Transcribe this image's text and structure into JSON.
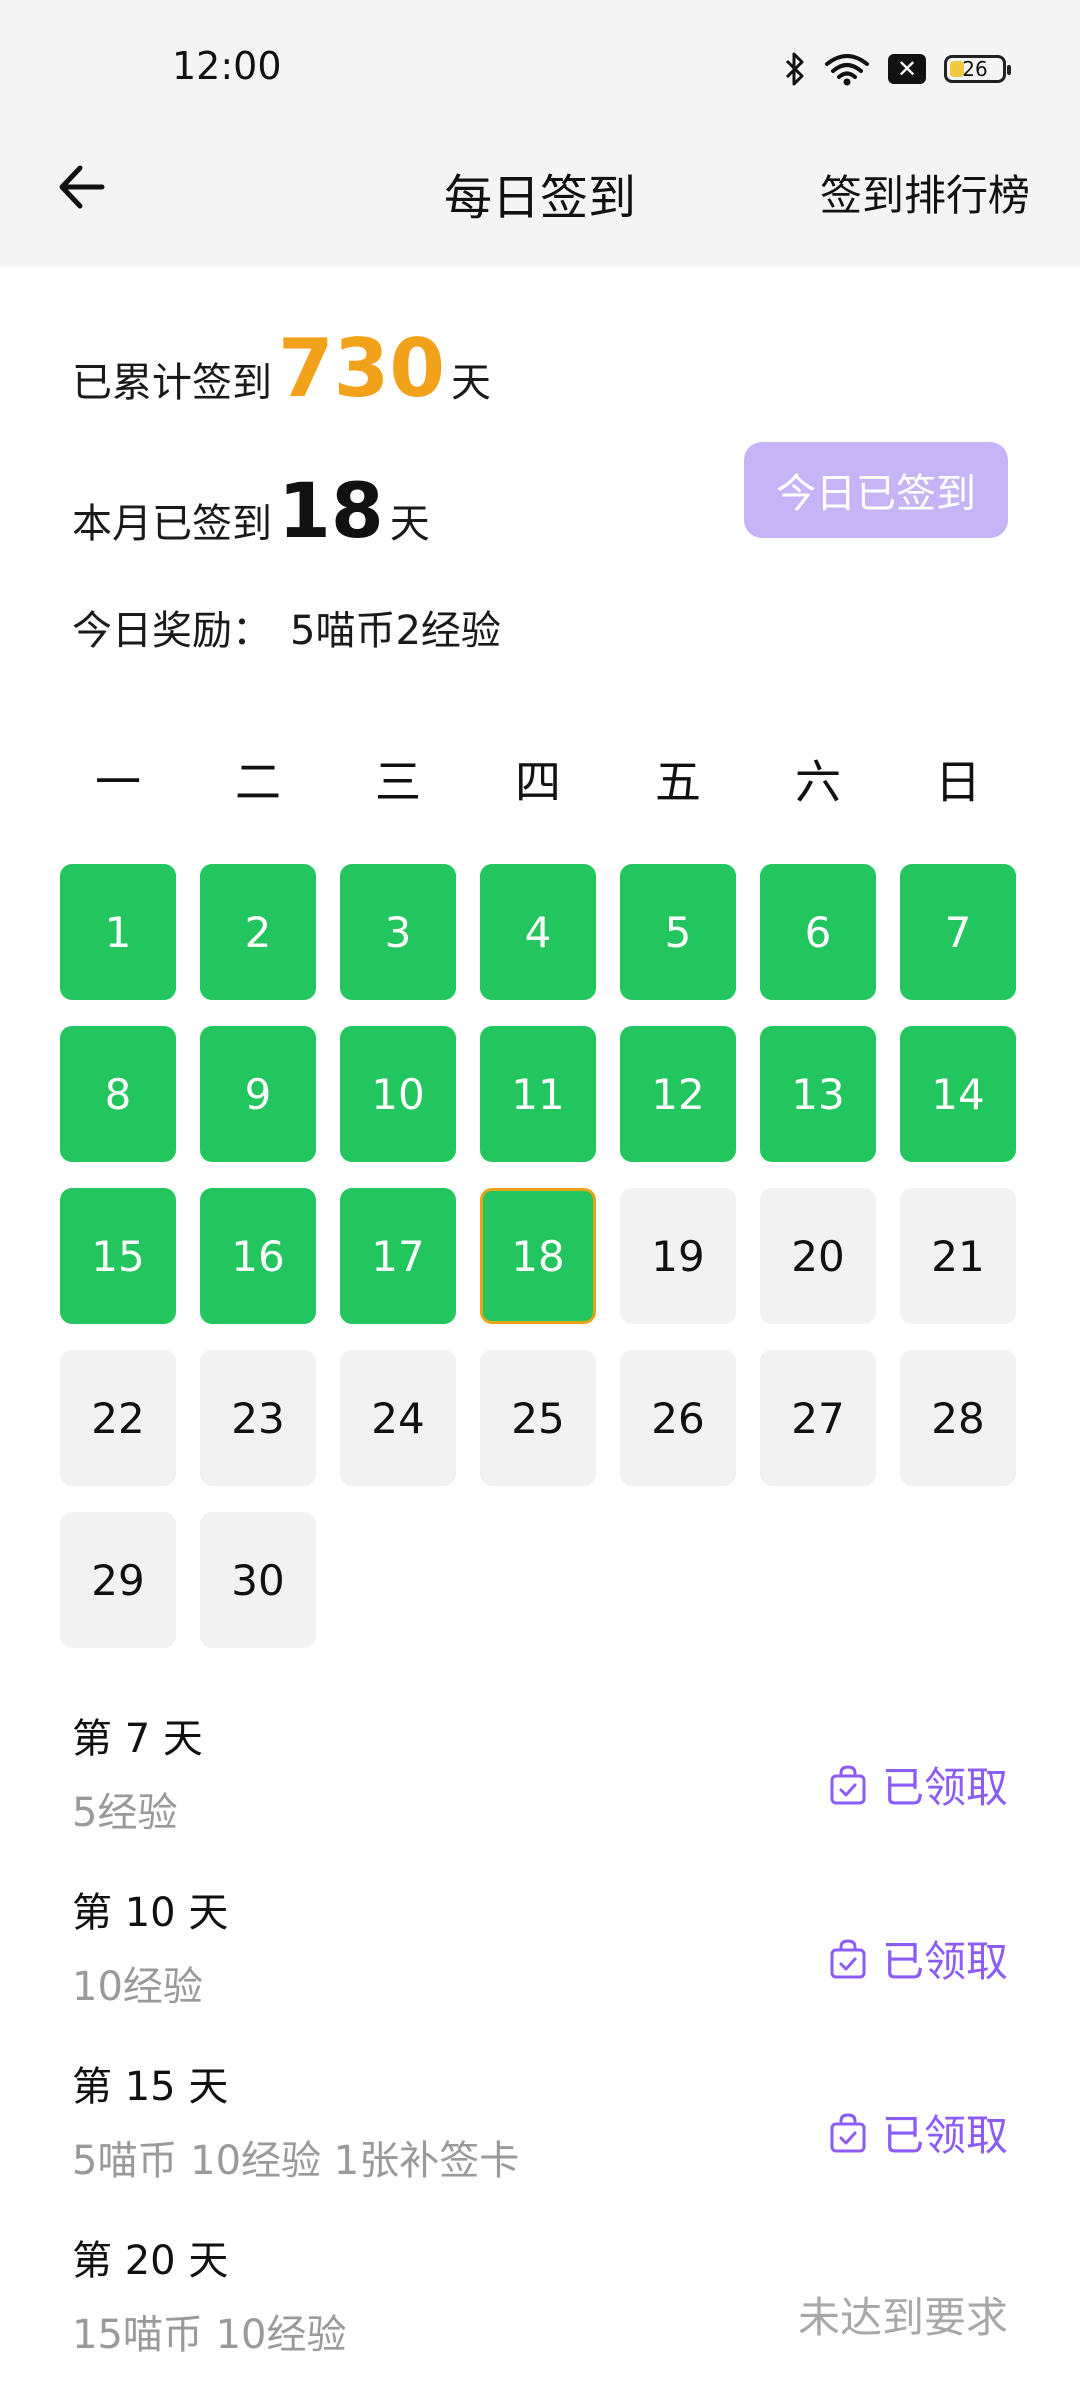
{
  "status_bar": {
    "time": "12:00",
    "battery": "26",
    "icons": [
      "bluetooth-icon",
      "wifi-icon",
      "x-icon",
      "battery-icon"
    ]
  },
  "nav": {
    "back_icon": "arrow-left-icon",
    "title": "每日签到",
    "rank_label": "签到排行榜"
  },
  "summary": {
    "total_prefix": "已累计签到",
    "total_days": "730",
    "total_suffix": "天",
    "month_prefix": "本月已签到",
    "month_days": "18",
    "month_suffix": "天",
    "checked_button": "今日已签到",
    "reward_label": "今日奖励：",
    "reward_value": "5喵币2经验",
    "colors": {
      "total_accent": "#f2a21a",
      "button_bg": "#c6b4f6"
    }
  },
  "calendar": {
    "weekdays": [
      "一",
      "二",
      "三",
      "四",
      "五",
      "六",
      "日"
    ],
    "days": [
      {
        "label": "1",
        "state": "signed"
      },
      {
        "label": "2",
        "state": "signed"
      },
      {
        "label": "3",
        "state": "signed"
      },
      {
        "label": "4",
        "state": "signed"
      },
      {
        "label": "5",
        "state": "signed"
      },
      {
        "label": "6",
        "state": "signed"
      },
      {
        "label": "7",
        "state": "signed"
      },
      {
        "label": "8",
        "state": "signed"
      },
      {
        "label": "9",
        "state": "signed"
      },
      {
        "label": "10",
        "state": "signed"
      },
      {
        "label": "11",
        "state": "signed"
      },
      {
        "label": "12",
        "state": "signed"
      },
      {
        "label": "13",
        "state": "signed"
      },
      {
        "label": "14",
        "state": "signed"
      },
      {
        "label": "15",
        "state": "signed"
      },
      {
        "label": "16",
        "state": "signed"
      },
      {
        "label": "17",
        "state": "signed"
      },
      {
        "label": "18",
        "state": "today"
      },
      {
        "label": "19",
        "state": "unsigned"
      },
      {
        "label": "20",
        "state": "unsigned"
      },
      {
        "label": "21",
        "state": "unsigned"
      },
      {
        "label": "22",
        "state": "unsigned"
      },
      {
        "label": "23",
        "state": "unsigned"
      },
      {
        "label": "24",
        "state": "unsigned"
      },
      {
        "label": "25",
        "state": "unsigned"
      },
      {
        "label": "26",
        "state": "unsigned"
      },
      {
        "label": "27",
        "state": "unsigned"
      },
      {
        "label": "28",
        "state": "unsigned"
      },
      {
        "label": "29",
        "state": "unsigned"
      },
      {
        "label": "30",
        "state": "unsigned"
      }
    ],
    "colors": {
      "signed": "#22c55e",
      "today_border": "#e6a319",
      "unsigned": "#f2f2f2"
    }
  },
  "rewards": [
    {
      "title": "第 7 天",
      "desc": "5经验",
      "status": "已领取",
      "claimed": true
    },
    {
      "title": "第 10 天",
      "desc": "10经验",
      "status": "已领取",
      "claimed": true
    },
    {
      "title": "第 15 天",
      "desc": "5喵币 10经验 1张补签卡",
      "status": "已领取",
      "claimed": true
    },
    {
      "title": "第 20 天",
      "desc": "15喵币 10经验",
      "status": "未达到要求",
      "claimed": false
    }
  ]
}
